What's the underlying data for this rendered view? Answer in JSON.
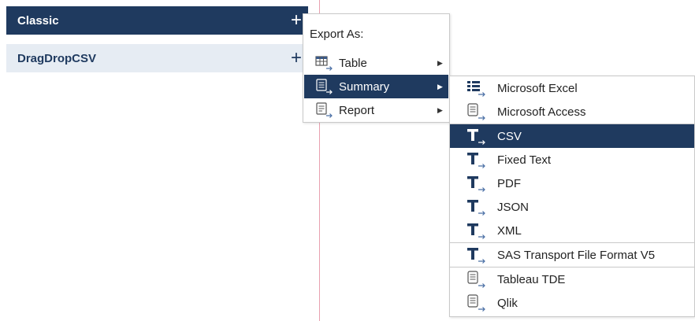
{
  "panels": [
    {
      "label": "Classic",
      "icon": "plus-icon"
    },
    {
      "label": "DragDropCSV",
      "icon": "plus-icon"
    }
  ],
  "export_menu": {
    "header": "Export As:",
    "items": [
      {
        "label": "Table",
        "icon": "table-export-icon"
      },
      {
        "label": "Summary",
        "icon": "summary-export-icon"
      },
      {
        "label": "Report",
        "icon": "report-export-icon"
      }
    ]
  },
  "format_menu": {
    "items": [
      {
        "label": "Microsoft Excel",
        "icon": "excel-icon"
      },
      {
        "label": "Microsoft Access",
        "icon": "database-icon"
      },
      {
        "label": "CSV",
        "icon": "text-icon"
      },
      {
        "label": "Fixed Text",
        "icon": "text-icon"
      },
      {
        "label": "PDF",
        "icon": "text-icon"
      },
      {
        "label": "JSON",
        "icon": "text-icon"
      },
      {
        "label": "XML",
        "icon": "text-icon"
      },
      {
        "label": "SAS Transport File Format V5",
        "icon": "text-icon"
      },
      {
        "label": "Tableau TDE",
        "icon": "database-icon"
      },
      {
        "label": "Qlik",
        "icon": "database-icon"
      }
    ]
  },
  "colors": {
    "accent": "#1f3a5f",
    "panel_light": "#e6ecf3",
    "divider": "#e8a0b0"
  }
}
